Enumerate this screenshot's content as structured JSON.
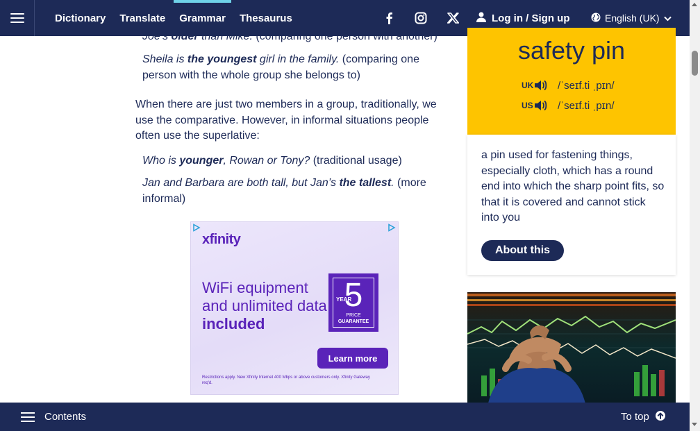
{
  "nav": {
    "links": [
      "Dictionary",
      "Translate",
      "Grammar",
      "Thesaurus"
    ],
    "active": "Grammar",
    "social_icons": [
      "facebook-icon",
      "instagram-icon",
      "x-icon"
    ],
    "login_label": "Log in / Sign up",
    "language": "English (UK)"
  },
  "article": {
    "ex1_pre": "Joe’s ",
    "ex1_bold": "older",
    "ex1_post": " than Mike.",
    "ex1_note": " (comparing one person with another)",
    "ex2_pre": "Sheila is ",
    "ex2_bold": "the youngest",
    "ex2_post": " girl in the family.",
    "ex2_note": " (comparing one person with the whole group she belongs to)",
    "para": "When there are just two members in a group, traditionally, we use the comparative. However, in informal situations people often use the superlative:",
    "ex3_pre": "Who is ",
    "ex3_bold": "younger",
    "ex3_post": ", Rowan or Tony?",
    "ex3_note": " (traditional usage)",
    "ex4_pre": "Jan and Barbara are both tall, but Jan’s ",
    "ex4_bold": "the tallest",
    "ex4_post": ".",
    "ex4_note": " (more informal)"
  },
  "ad": {
    "brand": "xfinity",
    "headline_pre": "WiFi equipment and unlimited data ",
    "headline_bold": "included",
    "badge_number": "5",
    "badge_year": "YEAR",
    "badge_price": "PRICE",
    "badge_guarantee": "GUARANTEE",
    "cta": "Learn more",
    "fine_print": "Restrictions apply. New Xfinity Internet 400 Mbps or above customers only. Xfinity Gateway req'd."
  },
  "wotd": {
    "word": "safety pin",
    "uk_label": "UK",
    "uk_ipa": "/ˈseɪf.ti ˌpɪn/",
    "us_label": "US",
    "us_ipa": "/ˈseɪf.ti ˌpɪn/",
    "definition": "a pin used for fastening things, especially cloth, which has a round end into which the sharp point fits, so that it is covered and cannot stick into you",
    "about_label": "About this"
  },
  "bottom": {
    "contents_label": "Contents",
    "totop_label": "To top"
  },
  "colors": {
    "navy": "#1d2a57",
    "yellow": "#fec400",
    "accent_cyan": "#6fd2e8",
    "ad_purple": "#5a23b9"
  }
}
